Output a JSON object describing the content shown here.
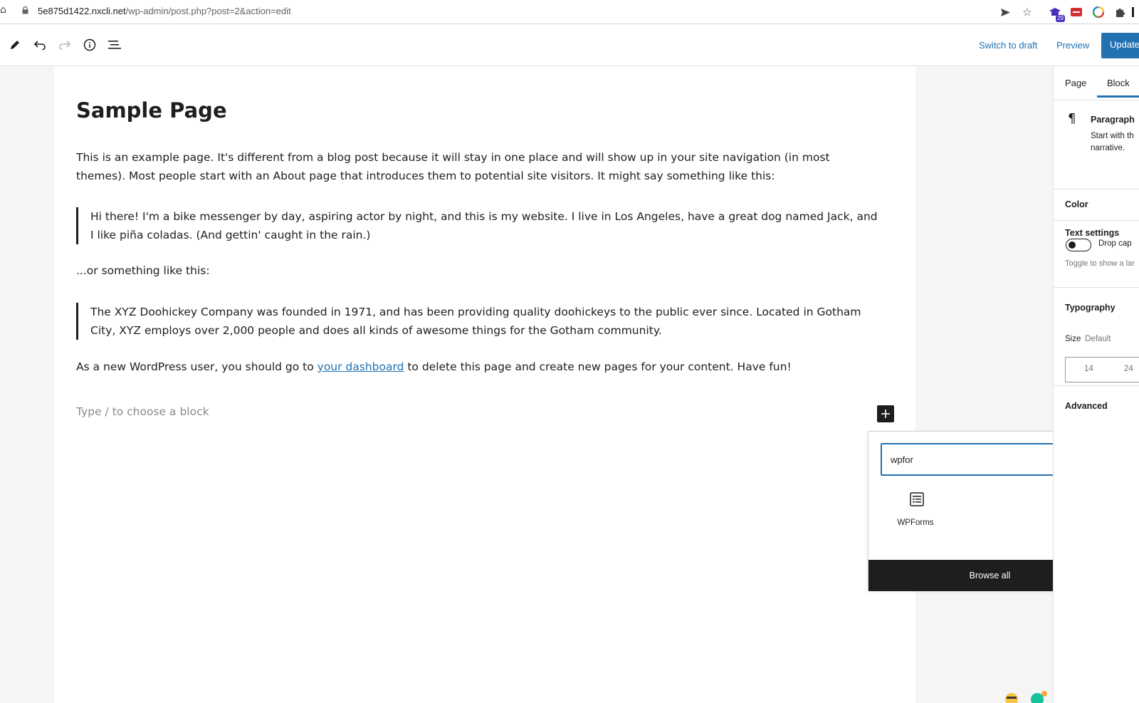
{
  "browser": {
    "url_host": "5e875d1422.nxcli.net",
    "url_path": "/wp-admin/post.php?post=2&action=edit",
    "extension_badge": "29"
  },
  "header": {
    "switch_to_draft": "Switch to draft",
    "preview": "Preview",
    "update": "Update"
  },
  "content": {
    "title": "Sample Page",
    "para1": "This is an example page. It's different from a blog post because it will stay in one place and will show up in your site navigation (in most themes). Most people start with an About page that introduces them to potential site visitors. It might say something like this:",
    "quote1": "Hi there! I'm a bike messenger by day, aspiring actor by night, and this is my website. I live in Los Angeles, have a great dog named Jack, and I like piña coladas. (And gettin' caught in the rain.)",
    "para2": "...or something like this:",
    "quote2": "The XYZ Doohickey Company was founded in 1971, and has been providing quality doohickeys to the public ever since. Located in Gotham City, XYZ employs over 2,000 people and does all kinds of awesome things for the Gotham community.",
    "para3_before": "As a new WordPress user, you should go to ",
    "para3_link": "your dashboard",
    "para3_after": " to delete this page and create new pages for your content. Have fun!",
    "placeholder": "Type / to choose a block"
  },
  "inserter": {
    "search_value": "wpfor",
    "results": [
      {
        "label": "WPForms",
        "icon": "form-icon"
      }
    ],
    "browse_all": "Browse all"
  },
  "sidebar": {
    "tabs": [
      "Page",
      "Block"
    ],
    "active_tab": "Block",
    "block_name": "Paragraph",
    "block_desc_line1": "Start with th",
    "block_desc_line2": "narrative.",
    "color_label": "Color",
    "text_settings_label": "Text settings",
    "drop_cap_label": "Drop cap",
    "drop_cap_help": "Toggle to show a lar",
    "typography_label": "Typography",
    "size_label": "Size",
    "size_value": "Default",
    "size_options": [
      "14",
      "24"
    ],
    "advanced_label": "Advanced"
  },
  "colors": {
    "accent": "#2271b1",
    "text": "#1e1e1e",
    "dark_button": "#1e1e1e"
  }
}
